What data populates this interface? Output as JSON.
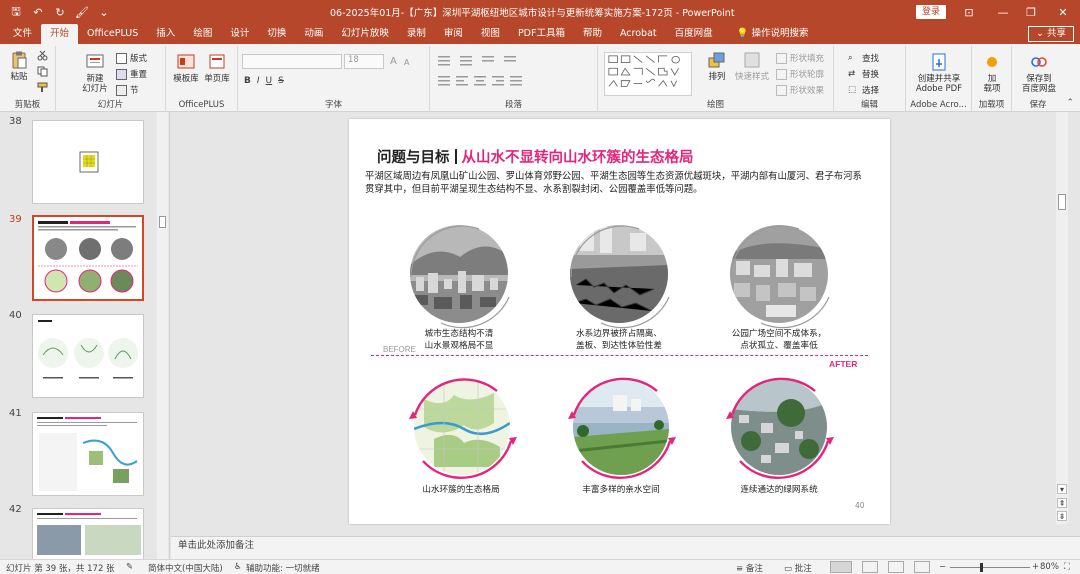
{
  "window": {
    "title": "06-2025年01月-【广东】深圳平湖枢纽地区城市设计与更新统筹实施方案-172页  -  PowerPoint",
    "login_label": "登录",
    "share_label": "共享",
    "share_glyph": "⌄"
  },
  "qat": {
    "save": "🖫",
    "undo": "↶",
    "redo": "↻",
    "format": "🖌",
    "more": "⌄"
  },
  "window_controls": {
    "ribbon": "⊡",
    "minimize": "—",
    "restore": "❐",
    "close": "✕"
  },
  "tabs": [
    "文件",
    "开始",
    "OfficePLUS",
    "插入",
    "绘图",
    "设计",
    "切换",
    "动画",
    "幻灯片放映",
    "录制",
    "审阅",
    "视图",
    "PDF工具箱",
    "帮助",
    "Acrobat",
    "百度网盘"
  ],
  "tell_me": {
    "icon": "💡",
    "label": "操作说明搜索"
  },
  "ribbon": {
    "clipboard": {
      "paste": "粘贴",
      "label": "剪贴板"
    },
    "slides": {
      "new_slide": "新建",
      "new_slide2": "幻灯片",
      "layout": "版式",
      "reset": "重置",
      "section": "节",
      "label": "幻灯片"
    },
    "officeplus": {
      "template": "模板库",
      "single": "单页库",
      "label": "OfficePLUS"
    },
    "font": {
      "size": "18",
      "bold": "B",
      "italic": "I",
      "underline": "U",
      "strike": "S",
      "label": "字体"
    },
    "paragraph": {
      "label": "段落"
    },
    "drawing": {
      "arrange": "排列",
      "quick_styles": "快速样式",
      "fill": "形状填充",
      "outline": "形状轮廓",
      "effects": "形状效果",
      "label": "绘图"
    },
    "editing": {
      "find": "查找",
      "replace": "替换",
      "select": "选择",
      "label": "编辑"
    },
    "adobe": {
      "create_1": "创建并共享",
      "create_2": "Adobe PDF",
      "label": "Adobe Acro..."
    },
    "addins": {
      "add_1": "加",
      "add_2": "载项",
      "label": "加载项"
    },
    "save": {
      "save_1": "保存到",
      "save_2": "百度网盘",
      "label": "保存"
    }
  },
  "thumbnails": [
    {
      "num": "38",
      "active": false
    },
    {
      "num": "39",
      "active": true
    },
    {
      "num": "40",
      "active": false
    },
    {
      "num": "41",
      "active": false
    },
    {
      "num": "42",
      "active": false
    }
  ],
  "slide": {
    "title_left": "问题与目标",
    "title_right": "从山水不显转向山水环簇的生态格局",
    "body": "平湖区域周边有凤凰山矿山公园、罗山体育郊野公园、平湖生态园等生态资源优越斑块，平湖内部有山厦河、君子布河系贯穿其中，但目前平湖呈现生态结构不显、水系割裂封闭、公园覆盖率低等问题。",
    "before_label": "BEFORE",
    "after_label": "AFTER",
    "captions_before": [
      [
        "城市生态结构不清",
        "山水景观格局不显"
      ],
      [
        "水系边界被挤占隔离、",
        "盖板、到达性体验性差"
      ],
      [
        "公园广场空间不成体系，",
        "点状孤立、覆盖率低"
      ]
    ],
    "captions_after": [
      "山水环簇的生态格局",
      "丰富多样的亲水空间",
      "连续通达的绿网系统"
    ],
    "page_number": "40"
  },
  "notes_placeholder": "单击此处添加备注",
  "status": {
    "slide_info": "幻灯片 第 39 张，共 172 张",
    "language": "简体中文(中国大陆)",
    "accessibility": "辅助功能: 一切就绪",
    "notes_btn": "备注",
    "comments_btn": "批注",
    "zoom": "80%",
    "zoom_value": 0.8
  },
  "colors": {
    "accent": "#b7472a",
    "pink": "#e4267b",
    "thumb_active": "#d24726"
  }
}
